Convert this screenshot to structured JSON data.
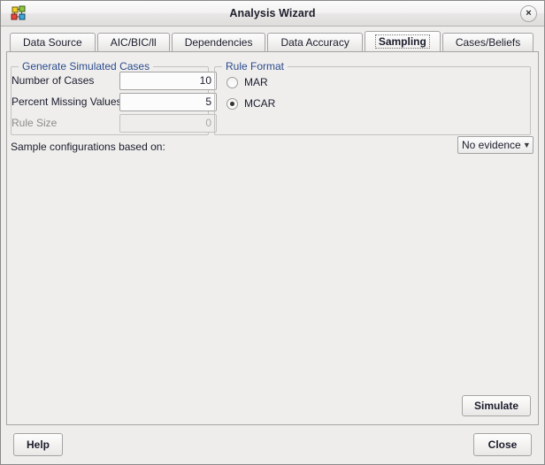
{
  "window": {
    "title": "Analysis Wizard",
    "app_icon": "network-graph-icon",
    "close_icon": "×"
  },
  "tabs": [
    {
      "label": "Data Source",
      "active": false
    },
    {
      "label": "AIC/BIC/ll",
      "active": false
    },
    {
      "label": "Dependencies",
      "active": false
    },
    {
      "label": "Data Accuracy",
      "active": false
    },
    {
      "label": "Sampling",
      "active": true
    },
    {
      "label": "Cases/Beliefs",
      "active": false
    }
  ],
  "generate_group": {
    "title": "Generate Simulated Cases",
    "fields": [
      {
        "label": "Number of Cases",
        "value": "10",
        "disabled": false
      },
      {
        "label": "Percent Missing Values",
        "value": "5",
        "disabled": false
      },
      {
        "label": "Rule Size",
        "value": "0",
        "disabled": true
      }
    ]
  },
  "rule_format_group": {
    "title": "Rule Format",
    "options": [
      {
        "label": "MAR",
        "selected": false
      },
      {
        "label": "MCAR",
        "selected": true
      }
    ]
  },
  "sample_config": {
    "label": "Sample configurations based on:",
    "selected": "No evidence",
    "arrow_icon": "chevron-down-icon"
  },
  "actions": {
    "simulate": "Simulate",
    "help": "Help",
    "close": "Close"
  },
  "colors": {
    "group_title": "#2b4b8c",
    "window_bg": "#eeedec",
    "panel_bg": "#efeeed",
    "border": "#a6a5a4"
  }
}
